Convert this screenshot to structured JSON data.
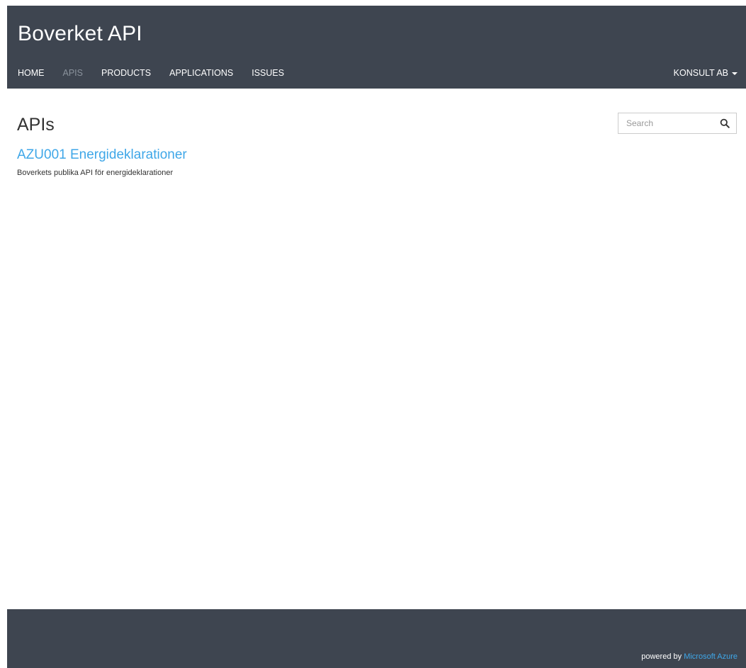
{
  "header": {
    "brand": "Boverket API",
    "nav": [
      {
        "label": "HOME",
        "active": false
      },
      {
        "label": "APIS",
        "active": true
      },
      {
        "label": "PRODUCTS",
        "active": false
      },
      {
        "label": "APPLICATIONS",
        "active": false
      },
      {
        "label": "ISSUES",
        "active": false
      }
    ],
    "user_menu": "KONSULT AB"
  },
  "main": {
    "title": "APIs",
    "search": {
      "placeholder": "Search",
      "value": "",
      "icon": "search-icon"
    },
    "apis": [
      {
        "name": "AZU001 Energideklarationer",
        "description": "Boverkets publika API för energideklarationer"
      }
    ]
  },
  "footer": {
    "powered_prefix": "powered by",
    "powered_link": "Microsoft Azure"
  },
  "colors": {
    "header_bg": "#3e4550",
    "link": "#3fa7e8",
    "nav_active": "#8a929c"
  }
}
